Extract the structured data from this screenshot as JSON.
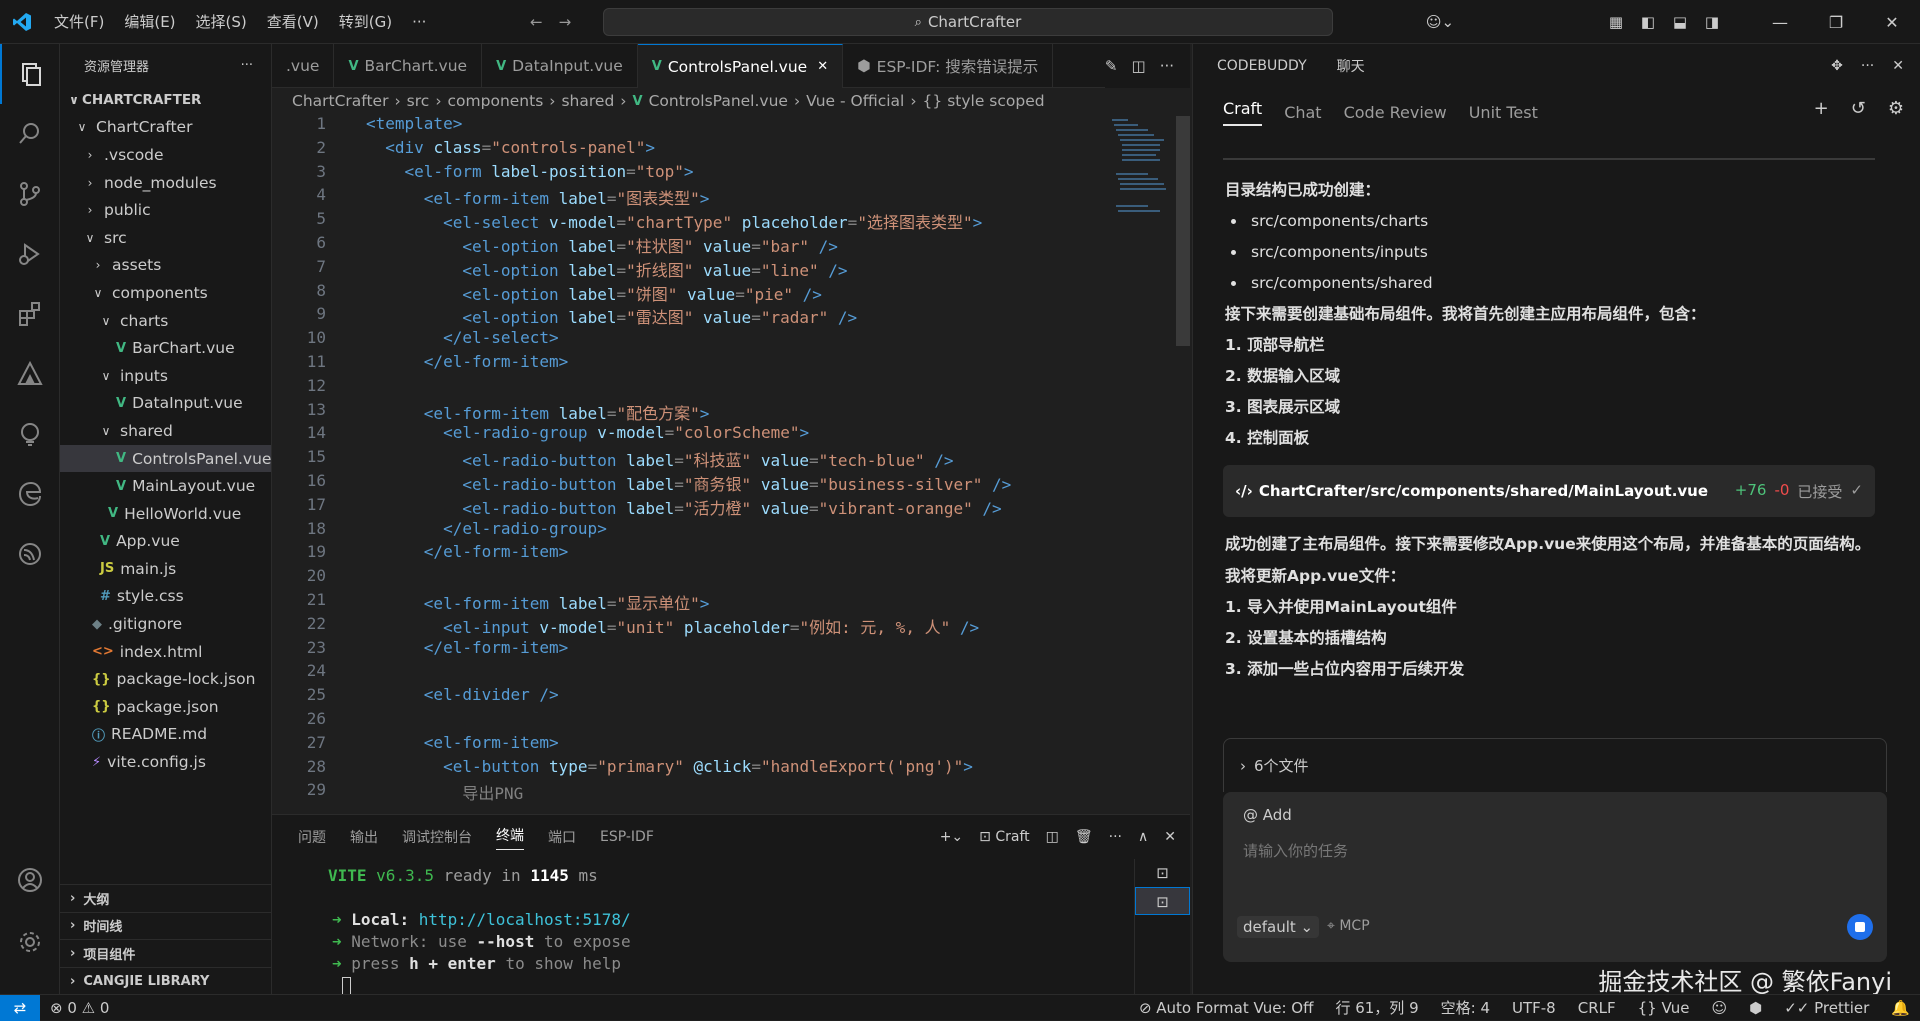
{
  "titlebar": {
    "menus": [
      "文件(F)",
      "编辑(E)",
      "选择(S)",
      "查看(V)",
      "转到(G)",
      "···"
    ],
    "search": "ChartCrafter"
  },
  "sidebar": {
    "title": "资源管理器",
    "root": "CHARTCRAFTER",
    "tree": [
      {
        "label": "ChartCrafter",
        "depth": 0,
        "chev": "v",
        "icon": ""
      },
      {
        "label": ".vscode",
        "depth": 1,
        "chev": ">",
        "icon": ""
      },
      {
        "label": "node_modules",
        "depth": 1,
        "chev": ">",
        "icon": ""
      },
      {
        "label": "public",
        "depth": 1,
        "chev": ">",
        "icon": ""
      },
      {
        "label": "src",
        "depth": 1,
        "chev": "v",
        "icon": ""
      },
      {
        "label": "assets",
        "depth": 2,
        "chev": ">",
        "icon": ""
      },
      {
        "label": "components",
        "depth": 2,
        "chev": "v",
        "icon": ""
      },
      {
        "label": "charts",
        "depth": 3,
        "chev": "v",
        "icon": ""
      },
      {
        "label": "BarChart.vue",
        "depth": 4,
        "chev": "",
        "icon": "vue"
      },
      {
        "label": "inputs",
        "depth": 3,
        "chev": "v",
        "icon": ""
      },
      {
        "label": "DataInput.vue",
        "depth": 4,
        "chev": "",
        "icon": "vue"
      },
      {
        "label": "shared",
        "depth": 3,
        "chev": "v",
        "icon": ""
      },
      {
        "label": "ControlsPanel.vue",
        "depth": 4,
        "chev": "",
        "icon": "vue",
        "selected": true
      },
      {
        "label": "MainLayout.vue",
        "depth": 4,
        "chev": "",
        "icon": "vue"
      },
      {
        "label": "HelloWorld.vue",
        "depth": 3,
        "chev": "",
        "icon": "vue"
      },
      {
        "label": "App.vue",
        "depth": 2,
        "chev": "",
        "icon": "vue"
      },
      {
        "label": "main.js",
        "depth": 2,
        "chev": "",
        "icon": "js"
      },
      {
        "label": "style.css",
        "depth": 2,
        "chev": "",
        "icon": "css"
      },
      {
        "label": ".gitignore",
        "depth": 1,
        "chev": "",
        "icon": "git"
      },
      {
        "label": "index.html",
        "depth": 1,
        "chev": "",
        "icon": "html"
      },
      {
        "label": "package-lock.json",
        "depth": 1,
        "chev": "",
        "icon": "json"
      },
      {
        "label": "package.json",
        "depth": 1,
        "chev": "",
        "icon": "json"
      },
      {
        "label": "README.md",
        "depth": 1,
        "chev": "",
        "icon": "info"
      },
      {
        "label": "vite.config.js",
        "depth": 1,
        "chev": "",
        "icon": "vite"
      }
    ],
    "sections": [
      "大纲",
      "时间线",
      "项目组件",
      "CANGJIE LIBRARY"
    ]
  },
  "editor": {
    "tabs": [
      {
        "label": ".vue",
        "icon": ""
      },
      {
        "label": "BarChart.vue",
        "icon": "vue"
      },
      {
        "label": "DataInput.vue",
        "icon": "vue"
      },
      {
        "label": "ControlsPanel.vue",
        "icon": "vue",
        "active": true
      },
      {
        "label": "ESP-IDF: 搜索错误提示",
        "icon": "esp"
      }
    ],
    "breadcrumbs": [
      "ChartCrafter",
      "src",
      "components",
      "shared",
      "ControlsPanel.vue",
      "Vue - Official",
      "{} style scoped"
    ],
    "lines": [
      [
        [
          "t",
          "<template>"
        ]
      ],
      [
        [
          "p",
          "  "
        ],
        [
          "t",
          "<div "
        ],
        [
          "a",
          "class"
        ],
        [
          "p",
          "="
        ],
        [
          "s",
          "\"controls-panel\""
        ],
        [
          "t",
          ">"
        ]
      ],
      [
        [
          "p",
          "    "
        ],
        [
          "t",
          "<el-form "
        ],
        [
          "a",
          "label-position"
        ],
        [
          "p",
          "="
        ],
        [
          "s",
          "\"top\""
        ],
        [
          "t",
          ">"
        ]
      ],
      [
        [
          "p",
          "      "
        ],
        [
          "t",
          "<el-form-item "
        ],
        [
          "a",
          "label"
        ],
        [
          "p",
          "="
        ],
        [
          "s",
          "\"图表类型\""
        ],
        [
          "t",
          ">"
        ]
      ],
      [
        [
          "p",
          "        "
        ],
        [
          "t",
          "<el-select "
        ],
        [
          "a",
          "v-model"
        ],
        [
          "p",
          "="
        ],
        [
          "s",
          "\"chartType\" "
        ],
        [
          "a",
          "placeholder"
        ],
        [
          "p",
          "="
        ],
        [
          "s",
          "\"选择图表类型\""
        ],
        [
          "t",
          ">"
        ]
      ],
      [
        [
          "p",
          "          "
        ],
        [
          "t",
          "<el-option "
        ],
        [
          "a",
          "label"
        ],
        [
          "p",
          "="
        ],
        [
          "s",
          "\"柱状图\" "
        ],
        [
          "a",
          "value"
        ],
        [
          "p",
          "="
        ],
        [
          "s",
          "\"bar\" "
        ],
        [
          "t",
          "/>"
        ]
      ],
      [
        [
          "p",
          "          "
        ],
        [
          "t",
          "<el-option "
        ],
        [
          "a",
          "label"
        ],
        [
          "p",
          "="
        ],
        [
          "s",
          "\"折线图\" "
        ],
        [
          "a",
          "value"
        ],
        [
          "p",
          "="
        ],
        [
          "s",
          "\"line\" "
        ],
        [
          "t",
          "/>"
        ]
      ],
      [
        [
          "p",
          "          "
        ],
        [
          "t",
          "<el-option "
        ],
        [
          "a",
          "label"
        ],
        [
          "p",
          "="
        ],
        [
          "s",
          "\"饼图\" "
        ],
        [
          "a",
          "value"
        ],
        [
          "p",
          "="
        ],
        [
          "s",
          "\"pie\" "
        ],
        [
          "t",
          "/>"
        ]
      ],
      [
        [
          "p",
          "          "
        ],
        [
          "t",
          "<el-option "
        ],
        [
          "a",
          "label"
        ],
        [
          "p",
          "="
        ],
        [
          "s",
          "\"雷达图\" "
        ],
        [
          "a",
          "value"
        ],
        [
          "p",
          "="
        ],
        [
          "s",
          "\"radar\" "
        ],
        [
          "t",
          "/>"
        ]
      ],
      [
        [
          "p",
          "        "
        ],
        [
          "t",
          "</el-select>"
        ]
      ],
      [
        [
          "p",
          "      "
        ],
        [
          "t",
          "</el-form-item>"
        ]
      ],
      [
        [
          "p",
          ""
        ]
      ],
      [
        [
          "p",
          "      "
        ],
        [
          "t",
          "<el-form-item "
        ],
        [
          "a",
          "label"
        ],
        [
          "p",
          "="
        ],
        [
          "s",
          "\"配色方案\""
        ],
        [
          "t",
          ">"
        ]
      ],
      [
        [
          "p",
          "        "
        ],
        [
          "t",
          "<el-radio-group "
        ],
        [
          "a",
          "v-model"
        ],
        [
          "p",
          "="
        ],
        [
          "s",
          "\"colorScheme\""
        ],
        [
          "t",
          ">"
        ]
      ],
      [
        [
          "p",
          "          "
        ],
        [
          "t",
          "<el-radio-button "
        ],
        [
          "a",
          "label"
        ],
        [
          "p",
          "="
        ],
        [
          "s",
          "\"科技蓝\" "
        ],
        [
          "a",
          "value"
        ],
        [
          "p",
          "="
        ],
        [
          "s",
          "\"tech-blue\" "
        ],
        [
          "t",
          "/>"
        ]
      ],
      [
        [
          "p",
          "          "
        ],
        [
          "t",
          "<el-radio-button "
        ],
        [
          "a",
          "label"
        ],
        [
          "p",
          "="
        ],
        [
          "s",
          "\"商务银\" "
        ],
        [
          "a",
          "value"
        ],
        [
          "p",
          "="
        ],
        [
          "s",
          "\"business-silver\" "
        ],
        [
          "t",
          "/>"
        ]
      ],
      [
        [
          "p",
          "          "
        ],
        [
          "t",
          "<el-radio-button "
        ],
        [
          "a",
          "label"
        ],
        [
          "p",
          "="
        ],
        [
          "s",
          "\"活力橙\" "
        ],
        [
          "a",
          "value"
        ],
        [
          "p",
          "="
        ],
        [
          "s",
          "\"vibrant-orange\" "
        ],
        [
          "t",
          "/>"
        ]
      ],
      [
        [
          "p",
          "        "
        ],
        [
          "t",
          "</el-radio-group>"
        ]
      ],
      [
        [
          "p",
          "      "
        ],
        [
          "t",
          "</el-form-item>"
        ]
      ],
      [
        [
          "p",
          ""
        ]
      ],
      [
        [
          "p",
          "      "
        ],
        [
          "t",
          "<el-form-item "
        ],
        [
          "a",
          "label"
        ],
        [
          "p",
          "="
        ],
        [
          "s",
          "\"显示单位\""
        ],
        [
          "t",
          ">"
        ]
      ],
      [
        [
          "p",
          "        "
        ],
        [
          "t",
          "<el-input "
        ],
        [
          "a",
          "v-model"
        ],
        [
          "p",
          "="
        ],
        [
          "s",
          "\"unit\" "
        ],
        [
          "a",
          "placeholder"
        ],
        [
          "p",
          "="
        ],
        [
          "s",
          "\"例如: 元, %, 人\" "
        ],
        [
          "t",
          "/>"
        ]
      ],
      [
        [
          "p",
          "      "
        ],
        [
          "t",
          "</el-form-item>"
        ]
      ],
      [
        [
          "p",
          ""
        ]
      ],
      [
        [
          "p",
          "      "
        ],
        [
          "t",
          "<el-divider "
        ],
        [
          "t",
          "/>"
        ]
      ],
      [
        [
          "p",
          ""
        ]
      ],
      [
        [
          "p",
          "      "
        ],
        [
          "t",
          "<el-form-item>"
        ]
      ],
      [
        [
          "p",
          "        "
        ],
        [
          "t",
          "<el-button "
        ],
        [
          "a",
          "type"
        ],
        [
          "p",
          "="
        ],
        [
          "s",
          "\"primary\" "
        ],
        [
          "a",
          "@click"
        ],
        [
          "p",
          "="
        ],
        [
          "s",
          "\"handleExport('png')\""
        ],
        [
          "t",
          ">"
        ]
      ],
      [
        [
          "p",
          "          导出PNG"
        ]
      ]
    ]
  },
  "panel": {
    "tabs": [
      "问题",
      "输出",
      "调试控制台",
      "终端",
      "端口",
      "ESP-IDF"
    ],
    "active_tab": "终端",
    "terminal_label": "Craft",
    "vite": "VITE",
    "version": "v6.3.5",
    "ready": "ready in",
    "ready_ms": "1145",
    "ready_unit": "ms",
    "local_label": "Local:",
    "local_url": "http://localhost:5178/",
    "network_label": "Network:",
    "network_use": "use",
    "network_flag": "--host",
    "network_tail": "to expose",
    "press": "press",
    "press_h": "h",
    "press_enter": "+ enter",
    "press_tail": "to show help"
  },
  "chat": {
    "header_title": "CODEBUDDY",
    "header_chat": "聊天",
    "tabs": [
      "Craft",
      "Chat",
      "Code Review",
      "Unit Test"
    ],
    "active_tab": "Craft",
    "msg1": "目录结构已成功创建：",
    "dirs": [
      "src/components/charts",
      "src/components/inputs",
      "src/components/shared"
    ],
    "msg2": "接下来需要创建基础布局组件。我将首先创建主应用布局组件，包含：",
    "plan1": [
      "1. 顶部导航栏",
      "2. 数据输入区域",
      "3. 图表展示区域",
      "4. 控制面板"
    ],
    "file_path": "ChartCrafter/src/components/shared/MainLayout.vue",
    "added": "+76",
    "removed": "-0",
    "accepted": "已接受",
    "msg3": "成功创建了主布局组件。接下来需要修改App.vue来使用这个布局，并准备基本的页面结构。",
    "msg4": "我将更新App.vue文件：",
    "plan2": [
      "1. 导入并使用MainLayout组件",
      "2. 设置基本的插槽结构",
      "3. 添加一些占位内容用于后续开发"
    ],
    "files_summary": "6个文件",
    "add_label": "@ Add",
    "input_placeholder": "请输入你的任务",
    "model": "default",
    "mcp": "MCP"
  },
  "watermark": "掘金技术社区 @ 繁依Fanyi",
  "status": {
    "errors": "0",
    "warnings": "0",
    "format": "Auto Format Vue: Off",
    "position": "行 61，列 9",
    "spaces": "空格: 4",
    "encoding": "UTF-8",
    "eol": "CRLF",
    "lang": "Vue",
    "prettier": "Prettier"
  }
}
